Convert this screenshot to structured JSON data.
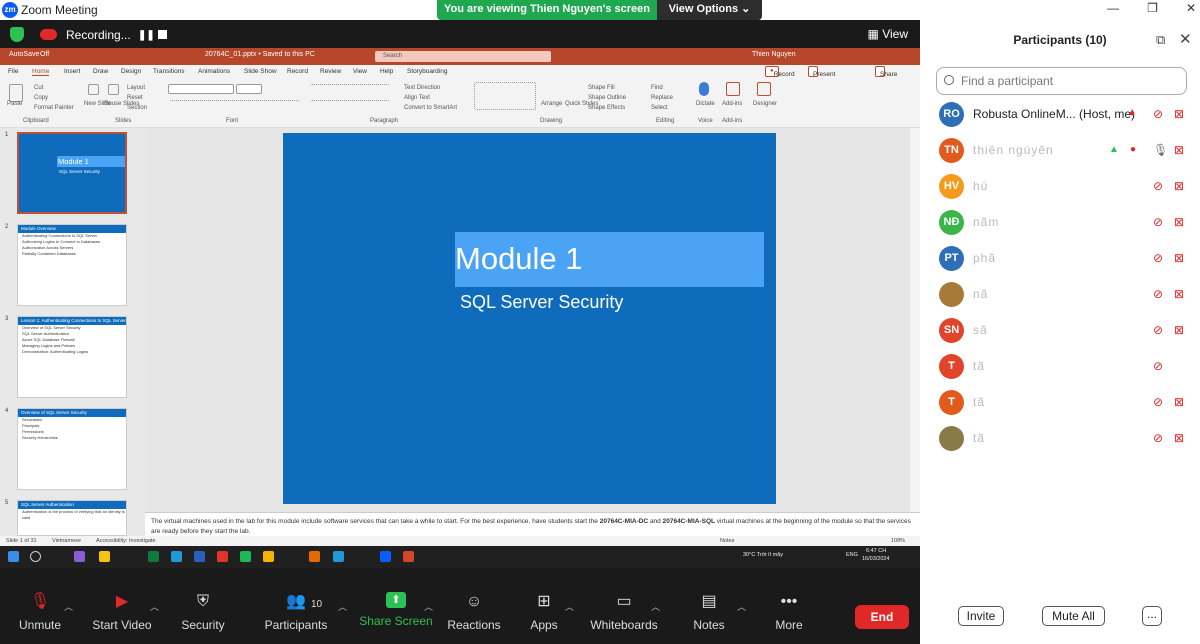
{
  "window": {
    "app_title": "Zoom Meeting",
    "logo_text": "zm",
    "banner_text": "You are viewing Thien Nguyen's screen",
    "view_options_label": "View Options",
    "recording_label": "Recording...",
    "view_label": "View"
  },
  "powerpoint": {
    "autosave": "AutoSave",
    "autosave_state": "Off",
    "file_title": "20764C_01.pptx • Saved to this PC",
    "search_placeholder": "Search",
    "user_name": "Thien Nguyen",
    "tabs": [
      "File",
      "Home",
      "Insert",
      "Draw",
      "Design",
      "Transitions",
      "Animations",
      "Slide Show",
      "Record",
      "Review",
      "View",
      "Help",
      "Storyboarding"
    ],
    "active_tab": "Home",
    "record_btn": "Record",
    "present_btn": "Present in Teams",
    "share_btn": "Share",
    "ribbon_groups": {
      "clipboard": "Clipboard",
      "slides": "Slides",
      "font": "Font",
      "paragraph": "Paragraph",
      "drawing": "Drawing",
      "editing": "Editing",
      "voice": "Voice",
      "addins": "Add-ins"
    },
    "ribbon_labels": {
      "paste": "Paste",
      "cut": "Cut",
      "copy": "Copy",
      "format_painter": "Format Painter",
      "new_slide": "New Slide",
      "reuse_slides": "Reuse Slides",
      "layout": "Layout",
      "reset": "Reset",
      "section": "Section",
      "text_direction": "Text Direction",
      "align_text": "Align Text",
      "convert_smartart": "Convert to SmartArt",
      "arrange": "Arrange",
      "quick_styles": "Quick Styles",
      "shape_fill": "Shape Fill",
      "shape_outline": "Shape Outline",
      "shape_effects": "Shape Effects",
      "find": "Find",
      "replace": "Replace",
      "select": "Select",
      "dictate": "Dictate",
      "addins": "Add-ins",
      "designer": "Designer"
    },
    "thumbnails": [
      {
        "num": "1",
        "title": "Module 1",
        "subtitle": "SQL Server Security"
      },
      {
        "num": "2",
        "title": "Module Overview",
        "lines": [
          "Authenticating Connections to SQL Server",
          "Authorizing Logins to Connect to Databases",
          "Authorization Across Servers",
          "Partially Contained Databases"
        ]
      },
      {
        "num": "3",
        "title": "Lesson 1: Authenticating Connections to SQL Server",
        "lines": [
          "Overview of SQL Server Security",
          "SQL Server Authentication",
          "Azure SQL Database Firewall",
          "Managing Logins and Policies",
          "Demonstration: Authenticating Logins"
        ]
      },
      {
        "num": "4",
        "title": "Overview of SQL Server Security",
        "lines": [
          "Securables",
          "Principals",
          "Permissions",
          "Security Hierarchies"
        ]
      },
      {
        "num": "5",
        "title": "SQL Server Authentication",
        "lines": [
          "Authentication is the process of verifying that an identity is valid"
        ]
      }
    ],
    "slide_title": "Module 1",
    "slide_subtitle": "SQL Server Security",
    "notes_html_parts": {
      "a": "The virtual machines used in the lab for this module include software services that can take a while to start. For the best experience, have students start the ",
      "b": "20764C-MIA-DC",
      "c": " and ",
      "d": "20764C-MIA-SQL",
      "e": " virtual machines at the beginning of the module so that the services are ready before they start the lab."
    },
    "status": {
      "slide_count": "Slide 1 of 31",
      "language": "Vietnamese",
      "accessibility": "Accessibility: Investigate",
      "notes": "Notes",
      "zoom": "108%"
    }
  },
  "taskbar": {
    "weather": "30°C  Trời ít mây",
    "lang": "ENG",
    "time": "6:47 CH",
    "date": "16/03/2024",
    "colors": [
      "#8a5cd6",
      "#f2c511",
      "#0e7a3d",
      "#1f9ad6",
      "#2b5fbd",
      "#e0352b",
      "#1db954",
      "#f5b400",
      "#e36a00",
      "#1f9ad6",
      "#0b5cff",
      "#d24726"
    ]
  },
  "toolbar": {
    "unmute": "Unmute",
    "start_video": "Start Video",
    "security": "Security",
    "participants": "Participants",
    "participants_count": "10",
    "share_screen": "Share Screen",
    "reactions": "Reactions",
    "apps": "Apps",
    "whiteboards": "Whiteboards",
    "notes": "Notes",
    "more": "More",
    "end": "End"
  },
  "panel": {
    "title": "Participants (10)",
    "find_placeholder": "Find a participant",
    "invite": "Invite",
    "mute_all": "Mute All",
    "more": "...",
    "participants": [
      {
        "initials": "RO",
        "name": "Robusta OnlineM... (Host, me)",
        "color": "#2f6fb5",
        "blur": false
      },
      {
        "initials": "TN",
        "name": "thiên ngúyên",
        "color": "#e25a1c",
        "blur": true
      },
      {
        "initials": "HV",
        "name": "hú",
        "color": "#f59a1c",
        "blur": true
      },
      {
        "initials": "NĐ",
        "name": "nãm",
        "color": "#3bb54a",
        "blur": true
      },
      {
        "initials": "PT",
        "name": "phã",
        "color": "#2f6fb5",
        "blur": true
      },
      {
        "initials": "",
        "name": "nã",
        "color": "#a67b3a",
        "blur": true
      },
      {
        "initials": "SN",
        "name": "sã",
        "color": "#e0452b",
        "blur": true
      },
      {
        "initials": "T",
        "name": "tã",
        "color": "#e0452b",
        "blur": true
      },
      {
        "initials": "T",
        "name": "tã",
        "color": "#e25a1c",
        "blur": true
      },
      {
        "initials": "",
        "name": "tã",
        "color": "#8a7a4a",
        "blur": true
      }
    ]
  }
}
